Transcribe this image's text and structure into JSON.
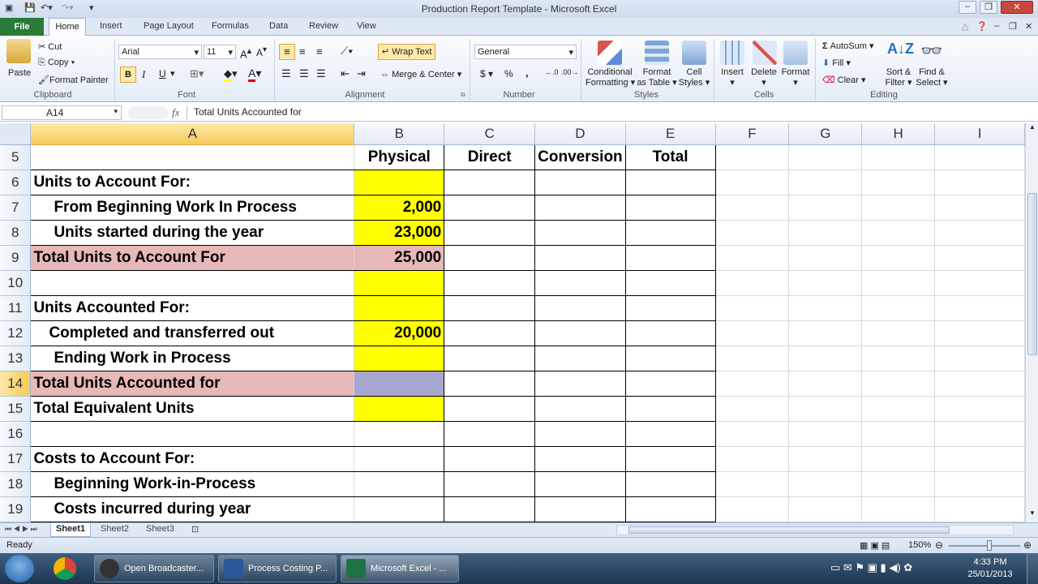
{
  "window": {
    "title": "Production Report Template - Microsoft Excel"
  },
  "tabs": [
    "File",
    "Home",
    "Insert",
    "Page Layout",
    "Formulas",
    "Data",
    "Review",
    "View"
  ],
  "ribbon": {
    "clipboard": {
      "paste": "Paste",
      "cut": "Cut",
      "copy": "Copy",
      "format_painter": "Format Painter",
      "label": "Clipboard"
    },
    "font": {
      "name": "Arial",
      "size": "11",
      "label": "Font",
      "bold": "B",
      "italic": "I",
      "underline": "U"
    },
    "alignment": {
      "wrap_text": "Wrap Text",
      "merge_center": "Merge & Center",
      "label": "Alignment"
    },
    "number": {
      "format": "General",
      "currency": "$",
      "percent": "%",
      "comma": ",",
      "label": "Number"
    },
    "styles": {
      "conditional_1": "Conditional",
      "conditional_2": "Formatting",
      "format_table_1": "Format",
      "format_table_2": "as Table",
      "cell_styles_1": "Cell",
      "cell_styles_2": "Styles",
      "label": "Styles"
    },
    "cells": {
      "insert": "Insert",
      "delete": "Delete",
      "format": "Format",
      "label": "Cells"
    },
    "editing": {
      "autosum": "AutoSum",
      "fill": "Fill",
      "clear": "Clear",
      "sort_1": "Sort &",
      "sort_2": "Filter",
      "find_1": "Find &",
      "find_2": "Select",
      "label": "Editing"
    }
  },
  "formula_bar": {
    "name_box": "A14",
    "fx": "fx",
    "content": "Total Units Accounted for"
  },
  "columns": [
    "A",
    "B",
    "C",
    "D",
    "E",
    "F",
    "G",
    "H",
    "I"
  ],
  "rows": [
    {
      "num": "5",
      "a": "",
      "b": "Physical",
      "c": "Direct",
      "d": "Conversion",
      "e": "Total"
    },
    {
      "num": "6",
      "a": "Units to Account For:",
      "b": "",
      "c": "",
      "d": "",
      "e": ""
    },
    {
      "num": "7",
      "a": "From Beginning Work In Process",
      "b": "2,000",
      "c": "",
      "d": "",
      "e": ""
    },
    {
      "num": "8",
      "a": "Units started during the year",
      "b": "23,000",
      "c": "",
      "d": "",
      "e": ""
    },
    {
      "num": "9",
      "a": "Total Units to Account For",
      "b": "25,000",
      "c": "",
      "d": "",
      "e": ""
    },
    {
      "num": "10",
      "a": "",
      "b": "",
      "c": "",
      "d": "",
      "e": ""
    },
    {
      "num": "11",
      "a": "Units Accounted For:",
      "b": "",
      "c": "",
      "d": "",
      "e": ""
    },
    {
      "num": "12",
      "a": "Completed and transferred out",
      "b": "20,000",
      "c": "",
      "d": "",
      "e": ""
    },
    {
      "num": "13",
      "a": "Ending Work in Process",
      "b": "",
      "c": "",
      "d": "",
      "e": ""
    },
    {
      "num": "14",
      "a": "Total Units Accounted for",
      "b": "",
      "c": "",
      "d": "",
      "e": ""
    },
    {
      "num": "15",
      "a": "Total Equivalent Units",
      "b": "",
      "c": "",
      "d": "",
      "e": ""
    },
    {
      "num": "16",
      "a": "",
      "b": "",
      "c": "",
      "d": "",
      "e": ""
    },
    {
      "num": "17",
      "a": "Costs to Account For:",
      "b": "",
      "c": "",
      "d": "",
      "e": ""
    },
    {
      "num": "18",
      "a": "Beginning Work-in-Process",
      "b": "",
      "c": "",
      "d": "",
      "e": ""
    },
    {
      "num": "19",
      "a": "Costs incurred during year",
      "b": "",
      "c": "",
      "d": "",
      "e": ""
    }
  ],
  "sheets": [
    "Sheet1",
    "Sheet2",
    "Sheet3"
  ],
  "status": {
    "ready": "Ready",
    "zoom": "150%"
  },
  "taskbar": {
    "items": [
      "Open Broadcaster...",
      "Process Costing P...",
      "Microsoft Excel - ..."
    ],
    "time": "4:33 PM",
    "date": "25/01/2013"
  },
  "colors": {
    "yellow": "#ffff00",
    "pink": "#e6b8b7",
    "selected": "#a6a6cf",
    "file_tab": "#2a7b37"
  }
}
